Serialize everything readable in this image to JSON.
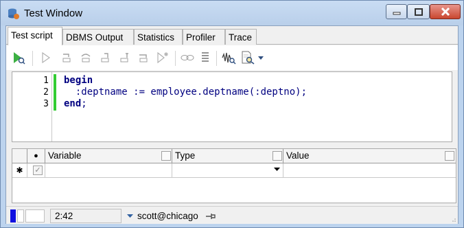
{
  "window": {
    "title": "Test Window"
  },
  "tabs": [
    {
      "label": "Test script",
      "active": true
    },
    {
      "label": "DBMS Output",
      "active": false
    },
    {
      "label": "Statistics",
      "active": false
    },
    {
      "label": "Profiler",
      "active": false
    },
    {
      "label": "Trace",
      "active": false
    }
  ],
  "toolbar": {
    "buttons": [
      "start-debugger-icon",
      "run-icon",
      "step-into-icon",
      "step-over-icon",
      "step-out-icon",
      "run-to-next-exception-icon",
      "run-to-cursor-icon",
      "toggle-breakpoint-icon",
      "link-icon",
      "align-icon",
      "waveform-icon",
      "search-document-icon",
      "dropdown-arrow-icon"
    ]
  },
  "editor": {
    "line_numbers": [
      "1",
      "2",
      "3"
    ],
    "lines": [
      {
        "kw": "begin",
        "rest": ""
      },
      {
        "kw": "",
        "rest": "  :deptname := employee.deptname(:deptno);"
      },
      {
        "kw": "end",
        "rest": ";"
      }
    ]
  },
  "variables": {
    "columns": [
      "Variable",
      "Type",
      "Value"
    ],
    "icon_col_glyph": "●",
    "new_row_marker": "✱",
    "check_glyph": "✓"
  },
  "statusbar": {
    "position": "2:42",
    "connection": "scott@chicago"
  },
  "colors": {
    "keyword": "#000080",
    "gutter_modified": "#33cc33",
    "close_button": "#c9462f"
  }
}
